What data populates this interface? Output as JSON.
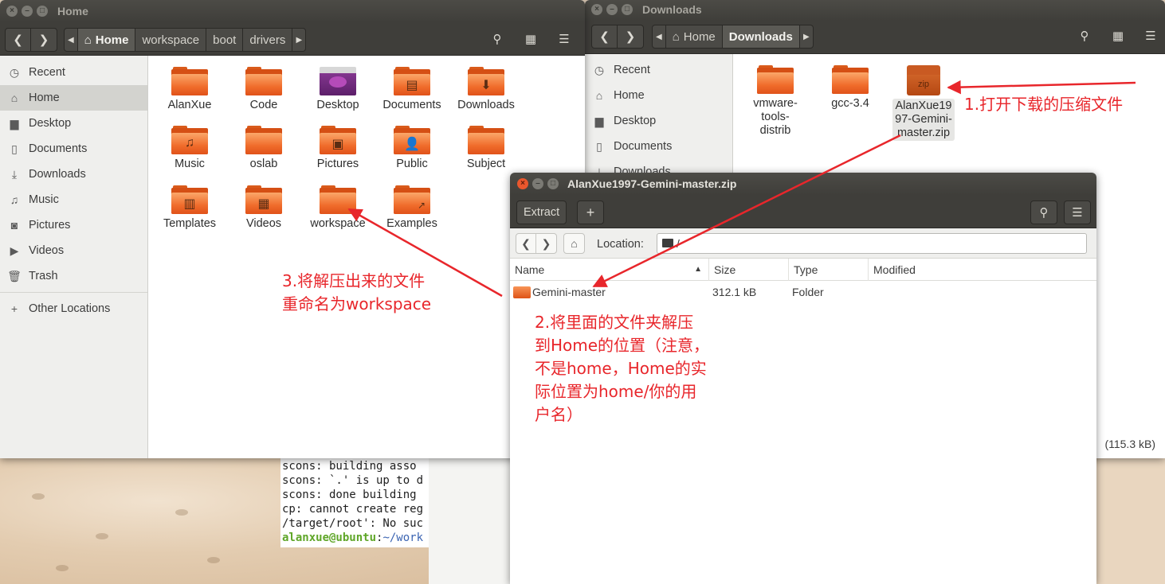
{
  "home_window": {
    "title": "Home",
    "breadcrumbs": [
      "Home",
      "workspace",
      "boot",
      "drivers"
    ],
    "sidebar": [
      "Recent",
      "Home",
      "Desktop",
      "Documents",
      "Downloads",
      "Music",
      "Pictures",
      "Videos",
      "Trash"
    ],
    "other_locations": "Other Locations",
    "items": [
      "AlanXue",
      "Code",
      "Desktop",
      "Documents",
      "Downloads",
      "Music",
      "oslab",
      "Pictures",
      "Public",
      "Subject",
      "Templates",
      "Videos",
      "workspace",
      "Examples"
    ]
  },
  "downloads_window": {
    "title": "Downloads",
    "breadcrumbs": [
      "Home",
      "Downloads"
    ],
    "sidebar": [
      "Recent",
      "Home",
      "Desktop",
      "Documents",
      "Downloads"
    ],
    "items": [
      "vmware-tools-distrib",
      "gcc-3.4",
      "AlanXue1997-Gemini-master.zip"
    ],
    "zip_icon_text": "zip",
    "status": "(115.3 kB)"
  },
  "archive_window": {
    "title": "AlanXue1997-Gemini-master.zip",
    "extract_label": "Extract",
    "location_label": "Location:",
    "location_value": "/",
    "columns": [
      "Name",
      "Size",
      "Type",
      "Modified"
    ],
    "rows": [
      {
        "name": "Gemini-master",
        "size": "312.1 kB",
        "type": "Folder",
        "modified": ""
      }
    ]
  },
  "terminal": {
    "lines": [
      "scons: building asso",
      "scons: `.' is up to d",
      "scons: done building",
      "cp: cannot create reg",
      "/target/root': No suc"
    ],
    "prompt_user": "alanxue@ubuntu",
    "prompt_sep": ":",
    "prompt_path": "~/work"
  },
  "annotations": {
    "note1": "1.打开下载的压缩文件",
    "note2": [
      "2.将里面的文件夹解压",
      "到Home的位置（注意，",
      "不是home，Home的实",
      "际位置为home/你的用",
      "户名）"
    ],
    "note3": [
      "3.将解压出来的文件",
      "重命名为workspace"
    ],
    "accent_color": "#e8262b"
  }
}
